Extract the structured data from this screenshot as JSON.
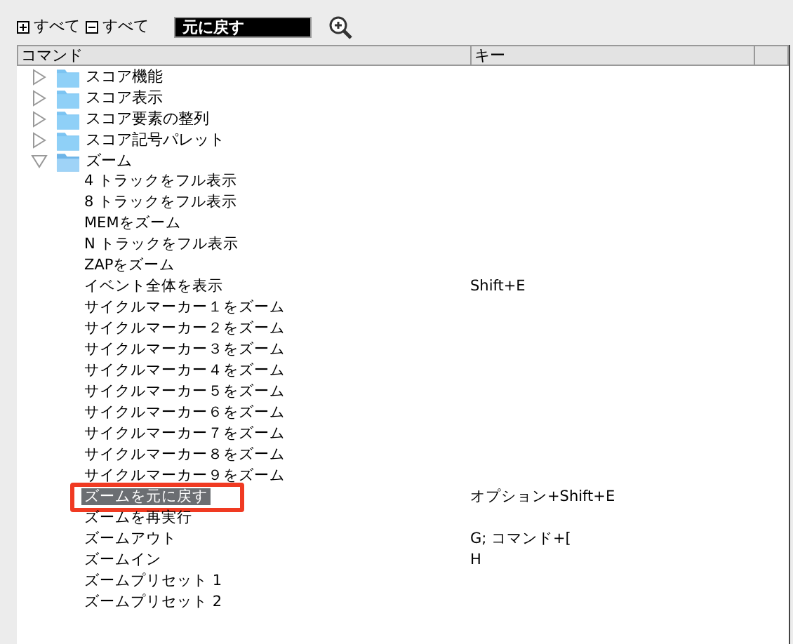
{
  "toolbar": {
    "expand_all": "すべて",
    "collapse_all": "すべて",
    "search": {
      "value": "元に戻す"
    }
  },
  "table": {
    "columns": [
      "コマンド",
      "キー"
    ],
    "rows": [
      {
        "label": "スコア機能",
        "expanded": false
      },
      {
        "label": "スコア表示",
        "expanded": false
      },
      {
        "label": "スコア要素の整列",
        "expanded": false
      },
      {
        "label": "スコア記号パレット",
        "expanded": false
      },
      {
        "label": "ズーム",
        "expanded": true,
        "children": [
          {
            "label": "4 トラックをフル表示",
            "selected": false
          },
          {
            "label": "8 トラックをフル表示",
            "selected": false
          },
          {
            "label": "MEMをズーム",
            "selected": false
          },
          {
            "label": "N トラックをフル表示",
            "selected": false
          },
          {
            "label": "ZAPをズーム",
            "selected": false
          },
          {
            "label": "イベント全体を表示",
            "key": "Shift+E",
            "selected": false
          },
          {
            "label": "サイクルマーカー１をズーム",
            "selected": false
          },
          {
            "label": "サイクルマーカー２をズーム",
            "selected": false
          },
          {
            "label": "サイクルマーカー３をズーム",
            "selected": false
          },
          {
            "label": "サイクルマーカー４をズーム",
            "selected": false
          },
          {
            "label": "サイクルマーカー５をズーム",
            "selected": false
          },
          {
            "label": "サイクルマーカー６をズーム",
            "selected": false
          },
          {
            "label": "サイクルマーカー７をズーム",
            "selected": false
          },
          {
            "label": "サイクルマーカー８をズーム",
            "selected": false
          },
          {
            "label": "サイクルマーカー９をズーム",
            "selected": false
          },
          {
            "label": "ズームを元に戻す",
            "key": "オプション+Shift+E",
            "selected": true
          },
          {
            "label": "ズームを再実行",
            "selected": false
          },
          {
            "label": "ズームアウト",
            "key": "G; コマンド+[",
            "selected": false
          },
          {
            "label": "ズームイン",
            "key": "H",
            "selected": false
          },
          {
            "label": "ズームプリセット 1",
            "selected": false
          },
          {
            "label": "ズームプリセット 2",
            "selected": false
          }
        ]
      }
    ]
  }
}
